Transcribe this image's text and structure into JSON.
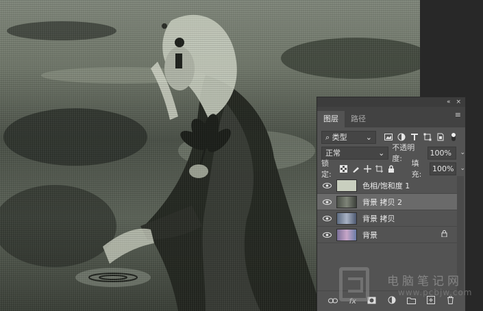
{
  "layers_panel": {
    "titlebar": {
      "collapse_glyph": "«",
      "close_glyph": "×"
    },
    "tabs": [
      {
        "label": "图层",
        "active": true
      },
      {
        "label": "路径",
        "active": false
      }
    ],
    "menu_glyph": "≡",
    "filter": {
      "search_glyph": "⌕",
      "label": "类型",
      "chevron": "⌄"
    },
    "blend": {
      "mode": "正常",
      "chevron": "⌄"
    },
    "opacity": {
      "label": "不透明度:",
      "value": "100%"
    },
    "lock": {
      "label": "锁定:"
    },
    "fill": {
      "label": "填充:",
      "value": "100%"
    },
    "layers": [
      {
        "name": "色相/饱和度 1",
        "selected": false,
        "locked": false,
        "thumb": "#c9cfbf"
      },
      {
        "name": "背景 拷贝 2",
        "selected": true,
        "locked": false,
        "thumb": "#5a6058"
      },
      {
        "name": "背景 拷贝",
        "selected": false,
        "locked": false,
        "thumb": "#6f7a8c"
      },
      {
        "name": "背景",
        "selected": false,
        "locked": true,
        "thumb": "#8a7fa0"
      }
    ],
    "bottom_icons": [
      "link-layers-icon",
      "fx-icon",
      "add-mask-icon",
      "adjustment-layer-icon",
      "group-icon",
      "new-layer-icon",
      "delete-layer-icon"
    ]
  },
  "watermark": {
    "text": "电脑笔记网",
    "url": "www.pcbjw.com"
  },
  "colors": {
    "panel_bg": "#535353",
    "selected_layer": "#6a6a6a",
    "app_bg": "#282828"
  }
}
